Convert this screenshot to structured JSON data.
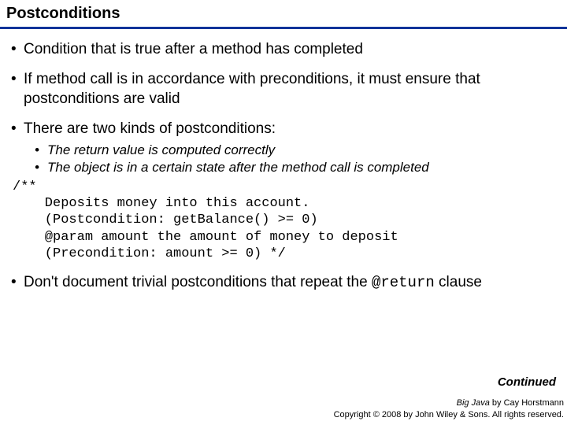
{
  "title": "Postconditions",
  "bullets": {
    "b1": "Condition that is true after a method has completed",
    "b2": "If method call is in accordance with preconditions, it must ensure that postconditions are valid",
    "b3": "There are two kinds of postconditions:",
    "sub1": "The return value is computed correctly",
    "sub2": "The object is in a certain state after the method call is completed",
    "b4_pre": "Don't document trivial postconditions that repeat the ",
    "b4_code": "@return",
    "b4_post": " clause"
  },
  "code": "/**\n    Deposits money into this account.\n    (Postcondition: getBalance() >= 0)\n    @param amount the amount of money to deposit\n    (Precondition: amount >= 0) */",
  "continued": "Continued",
  "footer": {
    "book": "Big Java",
    "byline": " by Cay Horstmann",
    "copyright": "Copyright © 2008 by John Wiley & Sons. All rights reserved."
  }
}
